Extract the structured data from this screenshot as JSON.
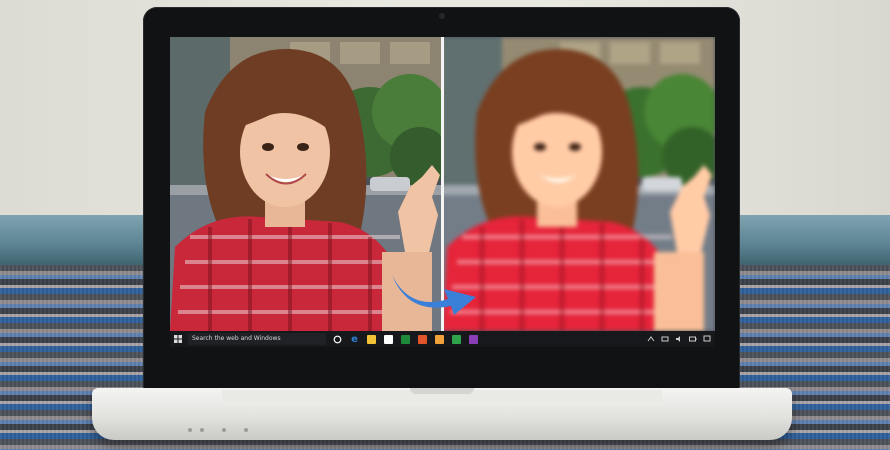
{
  "taskbar": {
    "search_text": "Search the web and Windows",
    "icons": [
      {
        "name": "cortana-icon",
        "color": "#ffffff"
      },
      {
        "name": "edge-icon",
        "color": "#2d7fd0"
      },
      {
        "name": "file-explorer-icon",
        "color": "#f2c237"
      },
      {
        "name": "store-icon",
        "color": "#ffffff"
      },
      {
        "name": "xbox-icon",
        "color": "#1f8a3a"
      },
      {
        "name": "office-icon",
        "color": "#e2542a"
      },
      {
        "name": "mail-icon",
        "color": "#f2a23a"
      },
      {
        "name": "photos-icon",
        "color": "#2fa44a"
      },
      {
        "name": "onenote-icon",
        "color": "#8a3fb8"
      }
    ]
  },
  "colors": {
    "arrow": "#3a7fd8",
    "shirt": "#c8283a",
    "hair": "#6e3d24"
  }
}
